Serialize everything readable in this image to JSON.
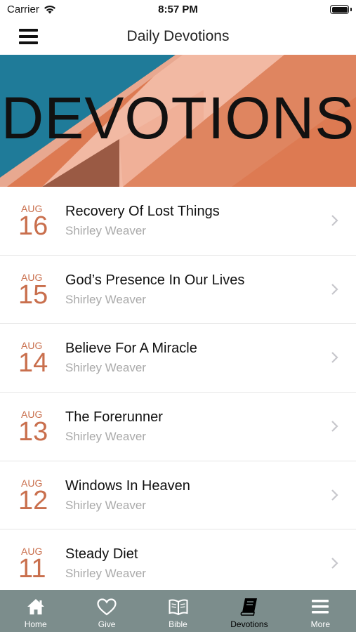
{
  "status_bar": {
    "carrier": "Carrier",
    "time": "8:57 PM"
  },
  "nav": {
    "title": "Daily Devotions"
  },
  "banner": {
    "text": "DEVOTIONS"
  },
  "devotions": [
    {
      "month": "AUG",
      "day": "16",
      "title": "Recovery Of Lost Things",
      "author": "Shirley Weaver"
    },
    {
      "month": "AUG",
      "day": "15",
      "title": "God’s Presence In Our Lives",
      "author": "Shirley Weaver"
    },
    {
      "month": "AUG",
      "day": "14",
      "title": "Believe For A Miracle",
      "author": "Shirley Weaver"
    },
    {
      "month": "AUG",
      "day": "13",
      "title": "The Forerunner",
      "author": "Shirley Weaver"
    },
    {
      "month": "AUG",
      "day": "12",
      "title": "Windows In Heaven",
      "author": "Shirley Weaver"
    },
    {
      "month": "AUG",
      "day": "11",
      "title": "Steady Diet",
      "author": "Shirley Weaver"
    }
  ],
  "tabs": [
    {
      "label": "Home",
      "icon": "home-icon"
    },
    {
      "label": "Give",
      "icon": "heart-icon"
    },
    {
      "label": "Bible",
      "icon": "open-book-icon"
    },
    {
      "label": "Devotions",
      "icon": "closed-book-icon",
      "active": true
    },
    {
      "label": "More",
      "icon": "menu-icon"
    }
  ],
  "colors": {
    "accent_date": "#c96f4d",
    "tabbar_bg": "#7c8d8c",
    "banner_teal": "#1f7b99",
    "banner_peach": "#f2b9a3",
    "banner_orange": "#dd7a52"
  }
}
